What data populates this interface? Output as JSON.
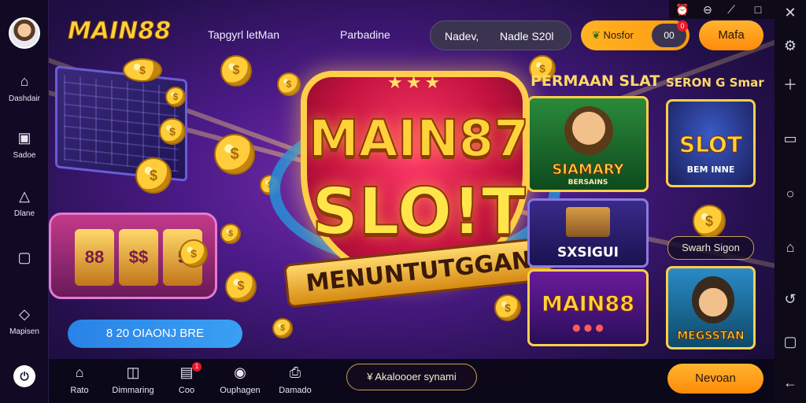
{
  "header": {
    "brand": "MAIN88",
    "nav": [
      "Tapgyrl letMan",
      "Parbadine"
    ],
    "search": {
      "left": "Nadev,",
      "right": "Nadle S20l"
    },
    "wallet": {
      "label": "Nosfor",
      "balance": "00",
      "badge": "0"
    },
    "cta": "Mafa"
  },
  "sidebar": {
    "items": [
      {
        "label": "Dashdair",
        "icon": "home-icon"
      },
      {
        "label": "Sadoe",
        "icon": "screen-icon"
      },
      {
        "label": "Dlane",
        "icon": "triangle-icon"
      },
      {
        "label": "",
        "icon": "chat-icon"
      },
      {
        "label": "Mapisen",
        "icon": "gift-icon"
      }
    ]
  },
  "hero": {
    "title_line1": "MAIN87",
    "title_line2": "SLO!T",
    "ribbon": "MENUNTUTGGAN"
  },
  "machine": {
    "reels": [
      "88",
      "$$",
      "5"
    ]
  },
  "games": {
    "section1_title": "PERMAAN SLAT",
    "section2_title": "SERON G Smar",
    "cards": [
      {
        "caption": "SIAMARY",
        "sub": "BERSAINS"
      },
      {
        "caption": "SXSIGUI"
      },
      {
        "caption": "MAIN88"
      },
      {
        "caption": "SLOT",
        "sub": "BEM INNE"
      },
      {
        "caption": "MEGSSTAN"
      }
    ],
    "side_pill": "Swarh Sigon"
  },
  "promo": {
    "label": "8 20 OIAONJ BRE"
  },
  "bottom": {
    "tabs": [
      {
        "label": "Rato",
        "icon": "home-icon"
      },
      {
        "label": "Dimmaring",
        "icon": "message-icon"
      },
      {
        "label": "Coo",
        "icon": "ticket-icon",
        "badge": "1"
      },
      {
        "label": "Ouphagen",
        "icon": "user-icon"
      },
      {
        "label": "Damado",
        "icon": "print-icon"
      }
    ],
    "marquee": "¥ Akaloooer synami",
    "cta": "Nevoan"
  },
  "colors": {
    "accent": "#ffb320",
    "brand_gold": "#ffd23a",
    "promo_blue": "#2a82e6"
  }
}
